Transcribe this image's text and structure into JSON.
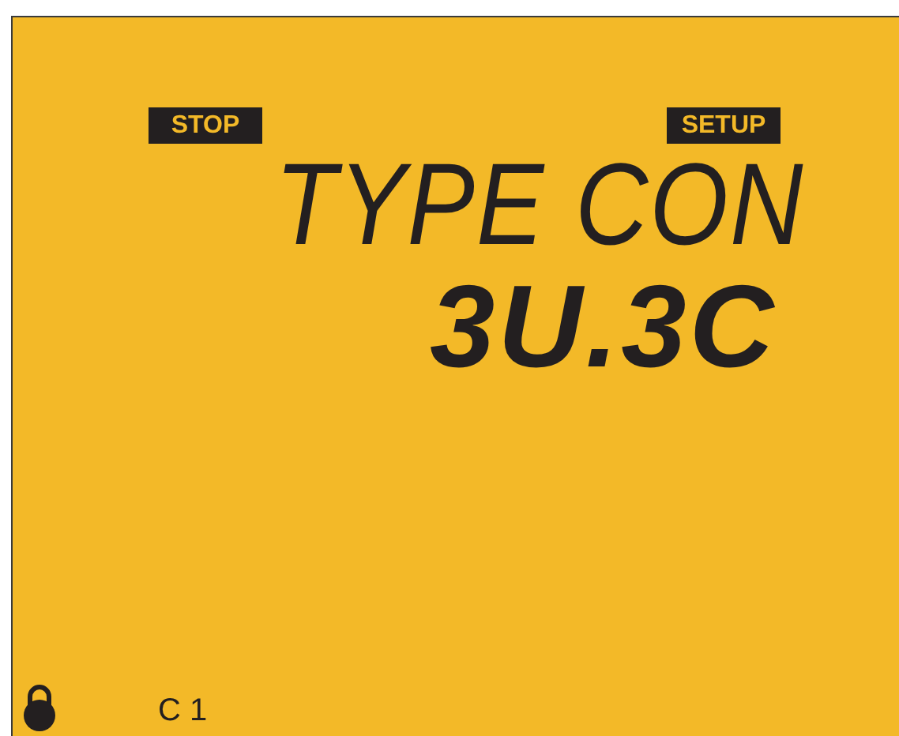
{
  "indicators": [
    {
      "label": "STOP"
    },
    {
      "label": "SETUP"
    }
  ],
  "display": {
    "line_1": "TYPE CON",
    "line_2": "3U.3C"
  },
  "status": {
    "locked": true,
    "channel": "C 1"
  }
}
